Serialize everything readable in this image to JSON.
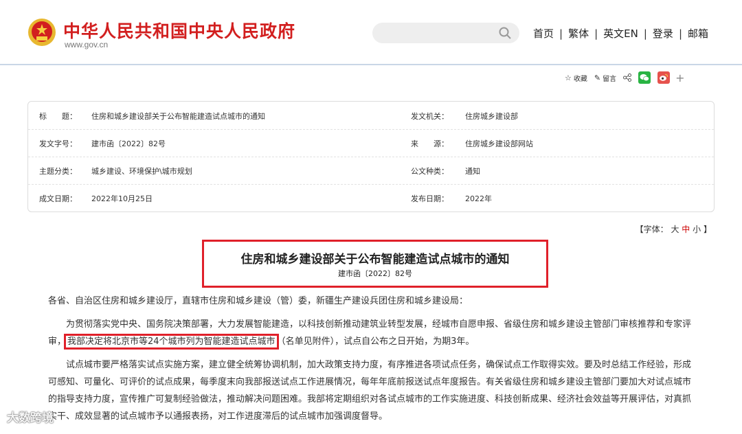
{
  "header": {
    "title": "中华人民共和国中央人民政府",
    "url": "www.gov.cn",
    "nav": [
      "首页",
      "繁体",
      "英文EN",
      "登录",
      "邮箱"
    ],
    "brand_color": "#d21f1f"
  },
  "share": {
    "favorite": "收藏",
    "comment": "留言"
  },
  "info": {
    "rows": [
      {
        "label1": "标　　题：",
        "value1": "住房和城乡建设部关于公布智能建造试点城市的通知",
        "label2": "发文机关：",
        "value2": "住房城乡建设部"
      },
      {
        "label1": "发文字号：",
        "value1": "建市函〔2022〕82号",
        "label2": "来　　源：",
        "value2": "住房城乡建设部网站"
      },
      {
        "label1": "主题分类：",
        "value1": "城乡建设、环境保护\\城市规划",
        "label2": "公文种类：",
        "value2": "通知"
      },
      {
        "label1": "成文日期：",
        "value1": "2022年10月25日",
        "label2": "发布日期：",
        "value2": "2022年"
      }
    ]
  },
  "font_size": {
    "prefix": "【字体：",
    "large": "大",
    "medium": "中",
    "small": "小",
    "suffix": "】"
  },
  "document": {
    "title": "住房和城乡建设部关于公布智能建造试点城市的通知",
    "number": "建市函〔2022〕82号",
    "salutation": "各省、自治区住房和城乡建设厅，直辖市住房和城乡建设（管）委，新疆生产建设兵团住房和城乡建设局：",
    "p1_pre": "为贯彻落实党中央、国务院决策部署，大力发展智能建造，以科技创新推动建筑业转型发展，经城市自愿申报、省级住房和城乡建设主管部门审核推荐和专家评审，",
    "p1_highlight": "我部决定将北京市等24个城市列为智能建造试点城市",
    "p1_post": "（名单见附件），试点自公布之日开始，为期3年。",
    "p2": "试点城市要严格落实试点实施方案，建立健全统筹协调机制，加大政策支持力度，有序推进各项试点任务，确保试点工作取得实效。要及时总结工作经验，形成可感知、可量化、可评价的试点成果，每季度末向我部报送试点工作进展情况，每年年底前报送试点年度报告。有关省级住房和城乡建设主管部门要加大对试点城市的指导支持力度，宣传推广可复制经验做法，推动解决问题困难。我部将定期组织对各试点城市的工作实施进度、科技创新成果、经济社会效益等开展评估，对真抓实干、成效显著的试点城市予以通报表扬，对工作进度滞后的试点城市加强调度督导。"
  },
  "watermark": "大数跨境"
}
